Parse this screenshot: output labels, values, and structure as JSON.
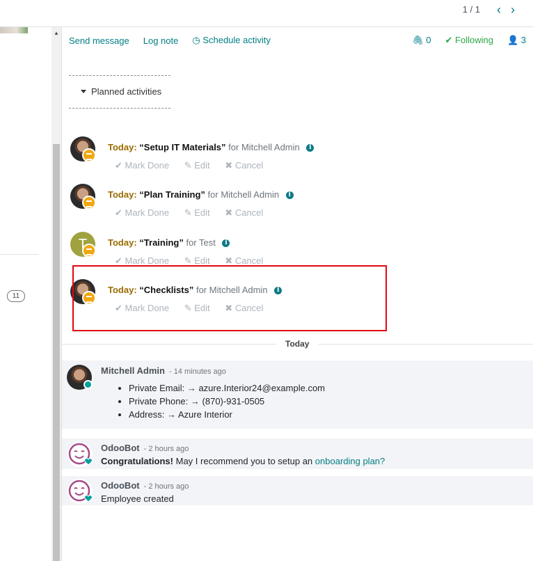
{
  "pager": {
    "count": "1 / 1",
    "prev_icon": "chevron-left-icon",
    "next_icon": "chevron-right-icon"
  },
  "left": {
    "badge": "11"
  },
  "chatter": {
    "send_message": "Send message",
    "log_note": "Log note",
    "schedule_activity": "Schedule activity",
    "attachments": "0",
    "following": "Following",
    "followers": "3"
  },
  "planned": {
    "label": "Planned activities"
  },
  "activities": [
    {
      "today": "Today:",
      "summary": "“Setup IT Materials”",
      "for": "for Mitchell Admin",
      "avatar": "photo"
    },
    {
      "today": "Today:",
      "summary": "“Plan Training”",
      "for": "for Mitchell Admin",
      "avatar": "photo"
    },
    {
      "today": "Today:",
      "summary": "“Training”",
      "for": "for Test",
      "avatar": "T"
    },
    {
      "today": "Today:",
      "summary": "“Checklists”",
      "for": "for Mitchell Admin",
      "avatar": "photo"
    }
  ],
  "activity_actions": {
    "mark_done": "Mark Done",
    "edit": "Edit",
    "cancel": "Cancel"
  },
  "separator": "Today",
  "messages": [
    {
      "author": "Mitchell Admin",
      "time": "- 14 minutes ago",
      "items": [
        {
          "label": "Private Email:",
          "arrow": "→",
          "value": "azure.Interior24@example.com"
        },
        {
          "label": "Private Phone:",
          "arrow": "→",
          "value": "(870)-931-0505"
        },
        {
          "label": "Address:",
          "arrow": "→",
          "value": "Azure Interior"
        }
      ]
    },
    {
      "author": "OdooBot",
      "time": "- 2 hours ago",
      "bold": "Congratulations!",
      "text": " May I recommend you to setup an ",
      "link": "onboarding plan?"
    },
    {
      "author": "OdooBot",
      "time": "- 2 hours ago",
      "text": "Employee created"
    }
  ],
  "colors": {
    "accent": "#017e84",
    "following": "#28a745",
    "today": "#9a6b00",
    "highlight": "#e30613"
  }
}
